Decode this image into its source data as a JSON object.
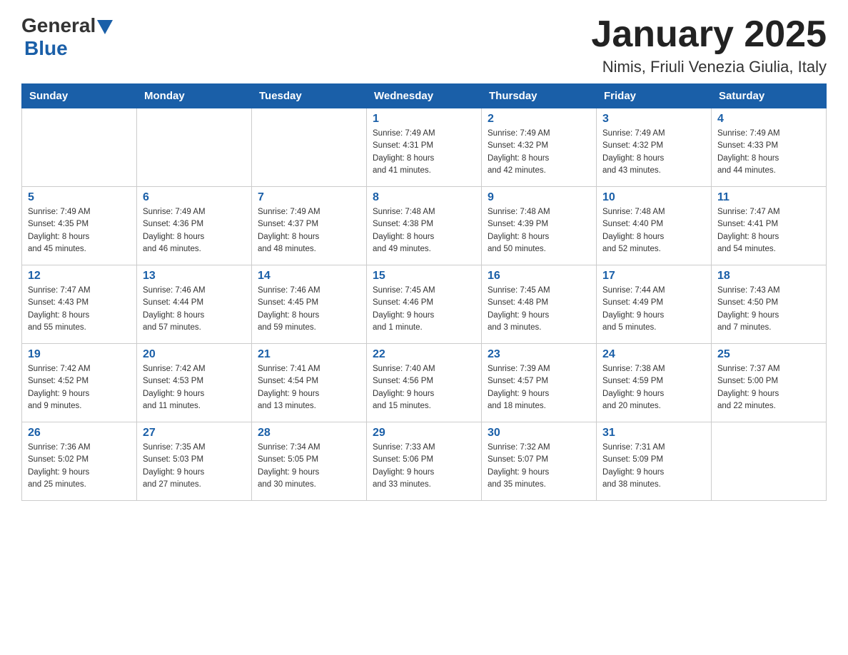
{
  "header": {
    "logo_general": "General",
    "logo_blue": "Blue",
    "month_title": "January 2025",
    "location": "Nimis, Friuli Venezia Giulia, Italy"
  },
  "weekdays": [
    "Sunday",
    "Monday",
    "Tuesday",
    "Wednesday",
    "Thursday",
    "Friday",
    "Saturday"
  ],
  "weeks": [
    [
      {
        "day": "",
        "info": ""
      },
      {
        "day": "",
        "info": ""
      },
      {
        "day": "",
        "info": ""
      },
      {
        "day": "1",
        "info": "Sunrise: 7:49 AM\nSunset: 4:31 PM\nDaylight: 8 hours\nand 41 minutes."
      },
      {
        "day": "2",
        "info": "Sunrise: 7:49 AM\nSunset: 4:32 PM\nDaylight: 8 hours\nand 42 minutes."
      },
      {
        "day": "3",
        "info": "Sunrise: 7:49 AM\nSunset: 4:32 PM\nDaylight: 8 hours\nand 43 minutes."
      },
      {
        "day": "4",
        "info": "Sunrise: 7:49 AM\nSunset: 4:33 PM\nDaylight: 8 hours\nand 44 minutes."
      }
    ],
    [
      {
        "day": "5",
        "info": "Sunrise: 7:49 AM\nSunset: 4:35 PM\nDaylight: 8 hours\nand 45 minutes."
      },
      {
        "day": "6",
        "info": "Sunrise: 7:49 AM\nSunset: 4:36 PM\nDaylight: 8 hours\nand 46 minutes."
      },
      {
        "day": "7",
        "info": "Sunrise: 7:49 AM\nSunset: 4:37 PM\nDaylight: 8 hours\nand 48 minutes."
      },
      {
        "day": "8",
        "info": "Sunrise: 7:48 AM\nSunset: 4:38 PM\nDaylight: 8 hours\nand 49 minutes."
      },
      {
        "day": "9",
        "info": "Sunrise: 7:48 AM\nSunset: 4:39 PM\nDaylight: 8 hours\nand 50 minutes."
      },
      {
        "day": "10",
        "info": "Sunrise: 7:48 AM\nSunset: 4:40 PM\nDaylight: 8 hours\nand 52 minutes."
      },
      {
        "day": "11",
        "info": "Sunrise: 7:47 AM\nSunset: 4:41 PM\nDaylight: 8 hours\nand 54 minutes."
      }
    ],
    [
      {
        "day": "12",
        "info": "Sunrise: 7:47 AM\nSunset: 4:43 PM\nDaylight: 8 hours\nand 55 minutes."
      },
      {
        "day": "13",
        "info": "Sunrise: 7:46 AM\nSunset: 4:44 PM\nDaylight: 8 hours\nand 57 minutes."
      },
      {
        "day": "14",
        "info": "Sunrise: 7:46 AM\nSunset: 4:45 PM\nDaylight: 8 hours\nand 59 minutes."
      },
      {
        "day": "15",
        "info": "Sunrise: 7:45 AM\nSunset: 4:46 PM\nDaylight: 9 hours\nand 1 minute."
      },
      {
        "day": "16",
        "info": "Sunrise: 7:45 AM\nSunset: 4:48 PM\nDaylight: 9 hours\nand 3 minutes."
      },
      {
        "day": "17",
        "info": "Sunrise: 7:44 AM\nSunset: 4:49 PM\nDaylight: 9 hours\nand 5 minutes."
      },
      {
        "day": "18",
        "info": "Sunrise: 7:43 AM\nSunset: 4:50 PM\nDaylight: 9 hours\nand 7 minutes."
      }
    ],
    [
      {
        "day": "19",
        "info": "Sunrise: 7:42 AM\nSunset: 4:52 PM\nDaylight: 9 hours\nand 9 minutes."
      },
      {
        "day": "20",
        "info": "Sunrise: 7:42 AM\nSunset: 4:53 PM\nDaylight: 9 hours\nand 11 minutes."
      },
      {
        "day": "21",
        "info": "Sunrise: 7:41 AM\nSunset: 4:54 PM\nDaylight: 9 hours\nand 13 minutes."
      },
      {
        "day": "22",
        "info": "Sunrise: 7:40 AM\nSunset: 4:56 PM\nDaylight: 9 hours\nand 15 minutes."
      },
      {
        "day": "23",
        "info": "Sunrise: 7:39 AM\nSunset: 4:57 PM\nDaylight: 9 hours\nand 18 minutes."
      },
      {
        "day": "24",
        "info": "Sunrise: 7:38 AM\nSunset: 4:59 PM\nDaylight: 9 hours\nand 20 minutes."
      },
      {
        "day": "25",
        "info": "Sunrise: 7:37 AM\nSunset: 5:00 PM\nDaylight: 9 hours\nand 22 minutes."
      }
    ],
    [
      {
        "day": "26",
        "info": "Sunrise: 7:36 AM\nSunset: 5:02 PM\nDaylight: 9 hours\nand 25 minutes."
      },
      {
        "day": "27",
        "info": "Sunrise: 7:35 AM\nSunset: 5:03 PM\nDaylight: 9 hours\nand 27 minutes."
      },
      {
        "day": "28",
        "info": "Sunrise: 7:34 AM\nSunset: 5:05 PM\nDaylight: 9 hours\nand 30 minutes."
      },
      {
        "day": "29",
        "info": "Sunrise: 7:33 AM\nSunset: 5:06 PM\nDaylight: 9 hours\nand 33 minutes."
      },
      {
        "day": "30",
        "info": "Sunrise: 7:32 AM\nSunset: 5:07 PM\nDaylight: 9 hours\nand 35 minutes."
      },
      {
        "day": "31",
        "info": "Sunrise: 7:31 AM\nSunset: 5:09 PM\nDaylight: 9 hours\nand 38 minutes."
      },
      {
        "day": "",
        "info": ""
      }
    ]
  ]
}
